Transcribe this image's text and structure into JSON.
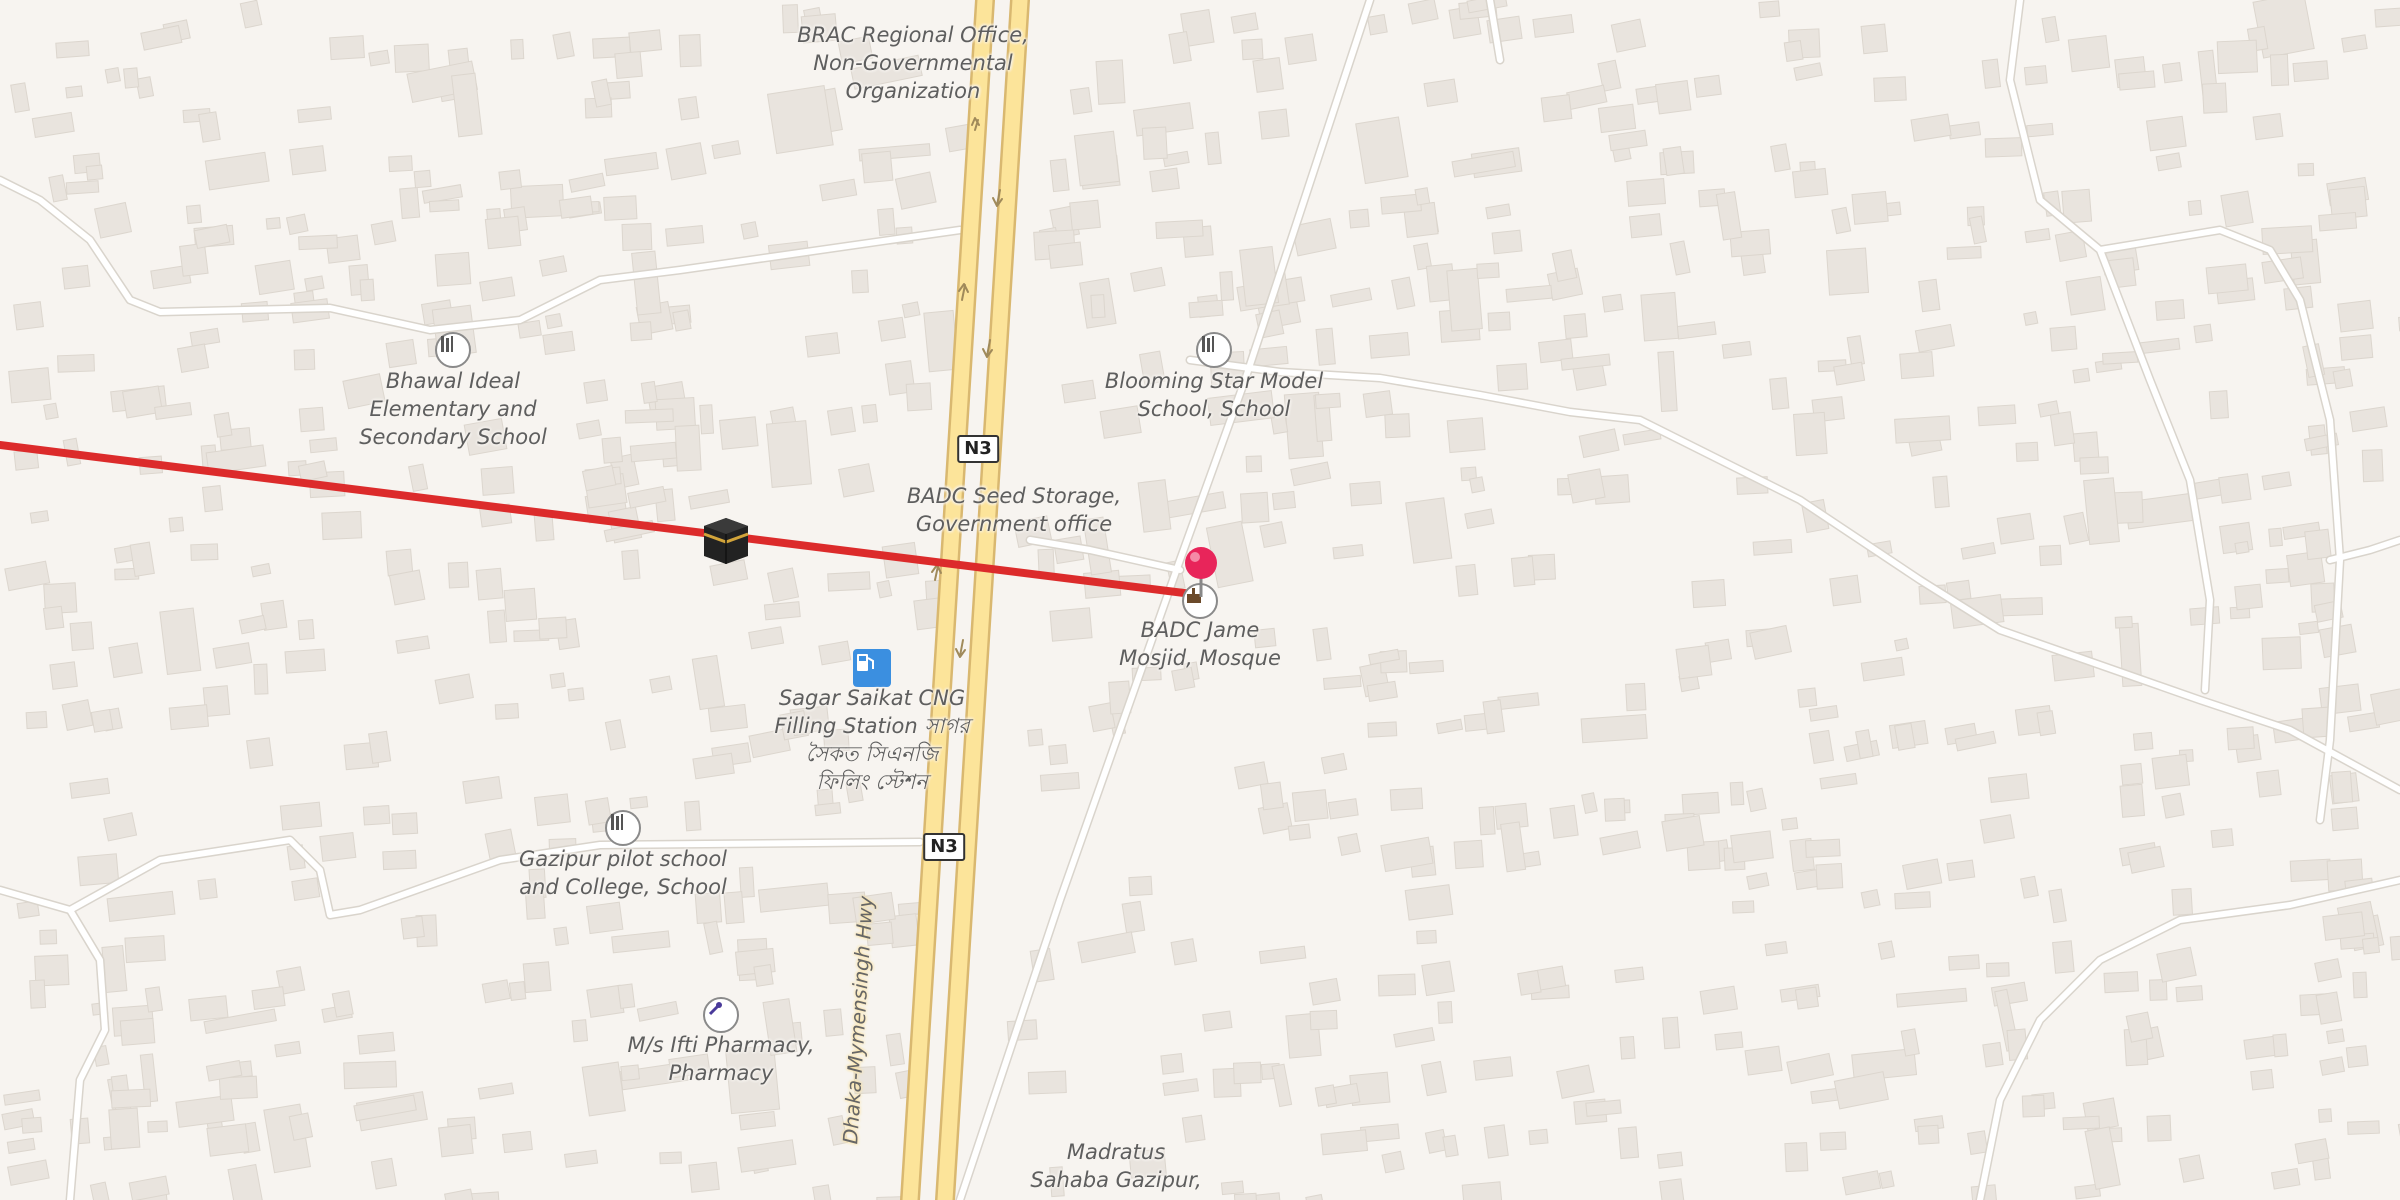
{
  "map": {
    "colors": {
      "background": "#f7f4f0",
      "building": "#e9e4de",
      "road": "#ffffff",
      "highway": "#fce49a",
      "route": "#dc2b2b",
      "pin": "#e8255a"
    },
    "route_line": {
      "description_visible": false
    },
    "pin": {
      "icon": "map-pin-icon",
      "target": "BADC Jame Mosjid, Mosque"
    },
    "kaaba_marker": {
      "icon": "kaaba-icon"
    },
    "labels": [
      {
        "id": "brac",
        "lines": [
          "BRAC Regional Office,",
          "Non-Governmental",
          "Organization"
        ]
      },
      {
        "id": "bhawal",
        "lines": [
          "Bhawal Ideal",
          "Elementary and",
          "Secondary School"
        ]
      },
      {
        "id": "blooming",
        "lines": [
          "Blooming Star Model",
          "School, School"
        ]
      },
      {
        "id": "badc-seed",
        "lines": [
          "BADC Seed Storage,",
          "Government office"
        ]
      },
      {
        "id": "badc-jame",
        "lines": [
          "BADC Jame",
          "Mosjid, Mosque"
        ]
      },
      {
        "id": "sagar",
        "lines": [
          "Sagar Saikat CNG",
          "Filling Station সাগর",
          "সৈকত সিএনজি",
          "ফিলিং স্টেশন"
        ]
      },
      {
        "id": "gazipur-pilot",
        "lines": [
          "Gazipur pilot school",
          "and College, School"
        ]
      },
      {
        "id": "ifti",
        "lines": [
          "M/s Ifti Pharmacy,",
          "Pharmacy"
        ]
      },
      {
        "id": "madratus",
        "lines": [
          "Madratus",
          "Sahaba Gazipur,"
        ]
      }
    ],
    "road_shields": [
      "N3",
      "N3"
    ],
    "highway_name": "Dhaka-Mymensingh Hwy"
  }
}
